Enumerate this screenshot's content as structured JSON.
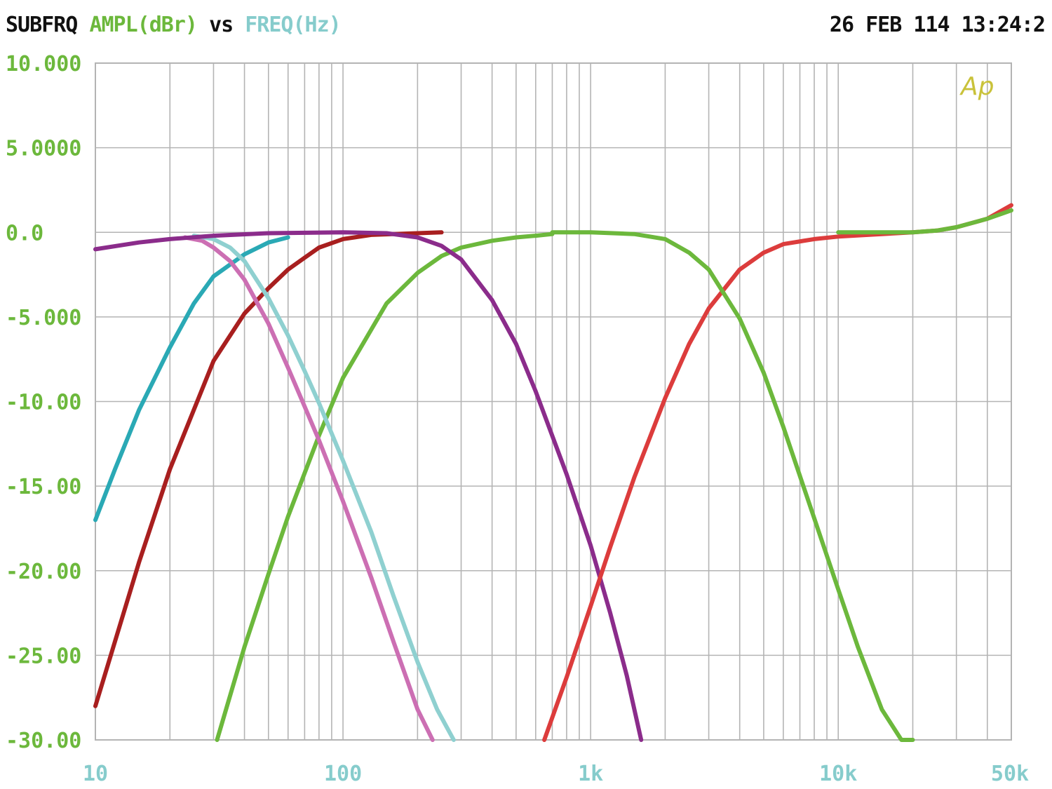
{
  "header": {
    "instrument": "SUBFRQ",
    "y_quantity": "AMPL(dBr)",
    "versus": "vs",
    "x_quantity": "FREQ(Hz)",
    "timestamp": "26 FEB 114 13:24:2"
  },
  "logo": "Ap",
  "colors": {
    "background": "#ffffff",
    "grid": "#b4b4b4",
    "text_dark": "#111111",
    "y_axis_text": "#6cb83c",
    "x_axis_text": "#86cccc",
    "logo": "#c9c23a"
  },
  "chart_data": {
    "type": "line",
    "xscale": "log",
    "xlim": [
      10,
      50000
    ],
    "ylim": [
      -30,
      10
    ],
    "grid": true,
    "ylabel": "AMPL(dBr)",
    "xlabel": "FREQ(Hz)",
    "y_ticks": [
      {
        "value": 10,
        "label": "10.000"
      },
      {
        "value": 5,
        "label": "5.0000"
      },
      {
        "value": 0,
        "label": "0.0"
      },
      {
        "value": -5,
        "label": "-5.000"
      },
      {
        "value": -10,
        "label": "-10.00"
      },
      {
        "value": -15,
        "label": "-15.00"
      },
      {
        "value": -20,
        "label": "-20.00"
      },
      {
        "value": -25,
        "label": "-25.00"
      },
      {
        "value": -30,
        "label": "-30.00"
      }
    ],
    "x_ticks": [
      {
        "value": 10,
        "label": "10"
      },
      {
        "value": 100,
        "label": "100"
      },
      {
        "value": 1000,
        "label": "1k"
      },
      {
        "value": 10000,
        "label": "10k"
      },
      {
        "value": 50000,
        "label": "50k"
      }
    ],
    "series": [
      {
        "color": "#2aa9b5",
        "x": [
          10,
          12,
          15,
          20,
          25,
          30,
          40,
          50,
          60
        ],
        "y": [
          -17,
          -14,
          -10.5,
          -6.8,
          -4.2,
          -2.6,
          -1.3,
          -0.6,
          -0.3
        ]
      },
      {
        "color": "#a81f1f",
        "x": [
          10,
          15,
          20,
          30,
          40,
          50,
          60,
          70,
          80,
          100,
          130,
          200,
          250
        ],
        "y": [
          -28,
          -19.5,
          -14,
          -7.6,
          -4.8,
          -3.3,
          -2.2,
          -1.5,
          -0.9,
          -0.4,
          -0.15,
          -0.05,
          0
        ]
      },
      {
        "color": "#6cb83c",
        "x": [
          31,
          40,
          50,
          60,
          80,
          100,
          150,
          200,
          250,
          300,
          400,
          500,
          600,
          700
        ],
        "y": [
          -30,
          -24.5,
          -20.2,
          -16.8,
          -12,
          -8.6,
          -4.2,
          -2.4,
          -1.4,
          -0.9,
          -0.5,
          -0.3,
          -0.2,
          -0.1
        ]
      },
      {
        "color": "#cc6fb3",
        "x": [
          23,
          27,
          30,
          35,
          40,
          50,
          60,
          70,
          80,
          100,
          130,
          160,
          200,
          230
        ],
        "y": [
          -0.3,
          -0.5,
          -0.9,
          -1.7,
          -2.8,
          -5.4,
          -8,
          -10.3,
          -12.3,
          -15.9,
          -20.4,
          -24.2,
          -28.2,
          -30
        ]
      },
      {
        "color": "#8fd0d0",
        "x": [
          25,
          30,
          35,
          40,
          50,
          60,
          70,
          80,
          100,
          130,
          160,
          200,
          240,
          280
        ],
        "y": [
          -0.2,
          -0.4,
          -0.9,
          -1.7,
          -3.9,
          -6.1,
          -8.2,
          -10.1,
          -13.5,
          -17.7,
          -21.5,
          -25.4,
          -28.2,
          -30
        ]
      },
      {
        "color": "#8b2c8b",
        "x": [
          10,
          15,
          20,
          30,
          50,
          100,
          150,
          200,
          250,
          300,
          400,
          500,
          600,
          800,
          1000,
          1200,
          1400,
          1600
        ],
        "y": [
          -1,
          -0.6,
          -0.4,
          -0.2,
          -0.05,
          0,
          -0.05,
          -0.3,
          -0.8,
          -1.6,
          -4,
          -6.6,
          -9.4,
          -14.3,
          -18.5,
          -22.5,
          -26.2,
          -30
        ]
      },
      {
        "color": "#dc3c3c",
        "x": [
          650,
          800,
          1000,
          1200,
          1500,
          2000,
          2500,
          3000,
          4000,
          5000,
          6000,
          8000,
          10000,
          15000,
          20000,
          25000,
          30000,
          40000,
          50000
        ],
        "y": [
          -30,
          -26.3,
          -22.1,
          -18.6,
          -14.5,
          -9.8,
          -6.6,
          -4.5,
          -2.2,
          -1.2,
          -0.7,
          -0.4,
          -0.25,
          -0.1,
          0,
          0.1,
          0.3,
          0.8,
          1.6
        ]
      },
      {
        "color": "#6cb83c",
        "x": [
          700,
          1000,
          1500,
          2000,
          2500,
          3000,
          4000,
          5000,
          6000,
          8000,
          10000,
          12000,
          15000,
          18000,
          20000
        ],
        "y": [
          0,
          0,
          -0.1,
          -0.4,
          -1.2,
          -2.2,
          -5.1,
          -8.3,
          -11.5,
          -16.9,
          -21.1,
          -24.5,
          -28.2,
          -30,
          -30
        ]
      },
      {
        "color": "#6cb83c",
        "x": [
          10000,
          15000,
          20000,
          25000,
          30000,
          40000,
          50000
        ],
        "y": [
          0,
          0,
          0,
          0.1,
          0.3,
          0.8,
          1.3
        ]
      }
    ]
  }
}
